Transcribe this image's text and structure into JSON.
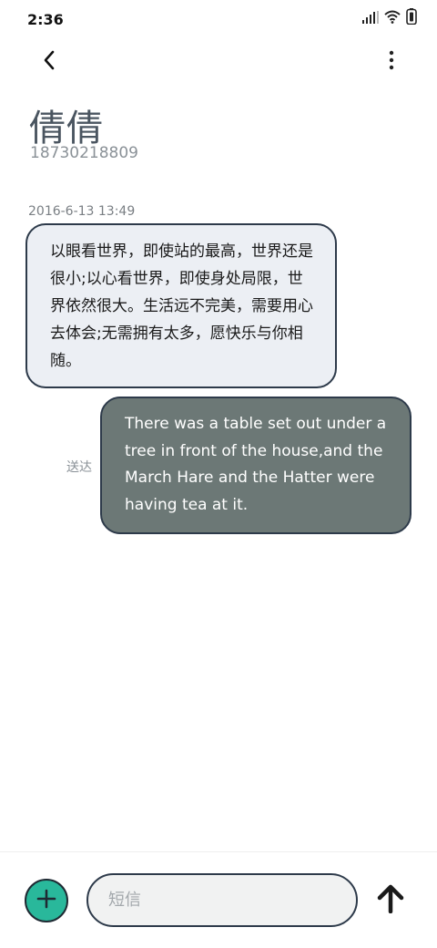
{
  "status_bar": {
    "time": "2:36",
    "icons": [
      "signal-icon",
      "wifi-icon",
      "battery-icon"
    ]
  },
  "header": {
    "back_icon": "back-arrow-icon",
    "more_icon": "more-vertical-icon"
  },
  "contact": {
    "name": "倩倩",
    "number": "18730218809"
  },
  "conversation": {
    "timestamp": "2016-6-13 13:49",
    "messages": [
      {
        "direction": "incoming",
        "text": "以眼看世界，即使站的最高，世界还是很小;以心看世界，即使身处局限，世界依然很大。生活远不完美，需要用心去体会;无需拥有太多，愿快乐与你相随。"
      },
      {
        "direction": "outgoing",
        "status": "送达",
        "text": "There was a table set out under a tree in front of the house,and the March Hare and the Hatter were having tea at it."
      }
    ]
  },
  "composer": {
    "add_icon": "plus-icon",
    "placeholder": "短信",
    "value": "",
    "send_icon": "send-arrow-icon"
  },
  "colors": {
    "accent": "#29b89b",
    "incoming_bubble": "#eceff4",
    "outgoing_bubble": "#6c7876",
    "bubble_border": "#2d3a4a"
  }
}
